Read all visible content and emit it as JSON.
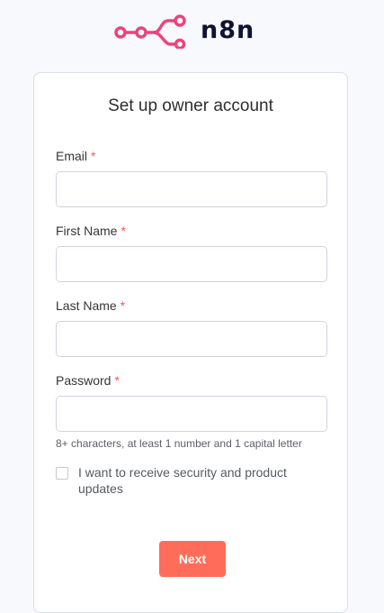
{
  "brand": {
    "name": "n8n",
    "logo_icon": "n8n-nodes-icon",
    "logo_color": "#e9457a"
  },
  "form": {
    "title": "Set up owner account",
    "fields": [
      {
        "label": "Email",
        "required_mark": "*",
        "value": ""
      },
      {
        "label": "First Name",
        "required_mark": "*",
        "value": ""
      },
      {
        "label": "Last Name",
        "required_mark": "*",
        "value": ""
      },
      {
        "label": "Password",
        "required_mark": "*",
        "value": ""
      }
    ],
    "password_hint": "8+ characters, at least 1 number and 1 capital letter",
    "updates_checkbox": {
      "label": "I want to receive security and product updates",
      "checked": false
    },
    "submit_label": "Next"
  },
  "colors": {
    "accent": "#ff6d5a",
    "required": "#f45959"
  }
}
